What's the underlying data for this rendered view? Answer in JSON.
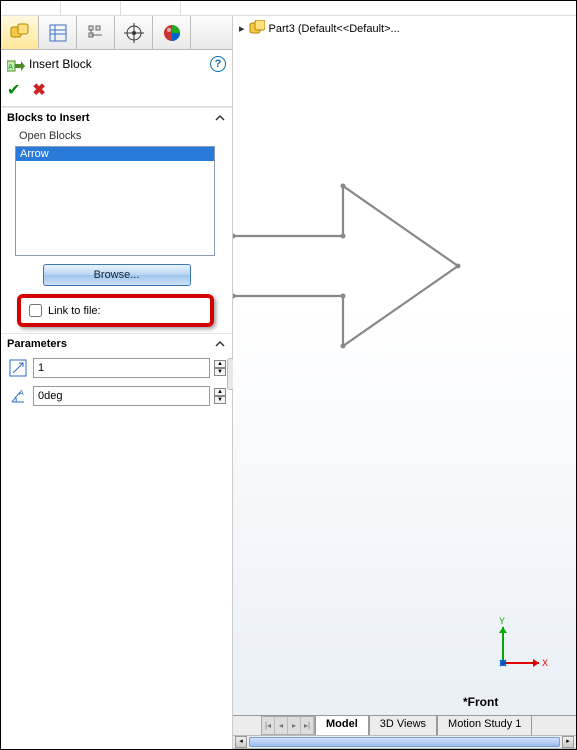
{
  "panel": {
    "title": "Insert Block",
    "sections": {
      "blocks": {
        "label": "Blocks to Insert",
        "sublabel": "Open Blocks",
        "items": [
          "Arrow"
        ],
        "browse_label": "Browse..."
      },
      "linkfile": {
        "label": "Link to file:"
      },
      "parameters": {
        "label": "Parameters",
        "scale_value": "1",
        "angle_value": "0deg"
      }
    }
  },
  "viewport": {
    "breadcrumb": "Part3  (Default<<Default>...",
    "axis_x": "X",
    "axis_y": "Y",
    "view_label": "*Front"
  },
  "tabs": {
    "model": "Model",
    "views3d": "3D Views",
    "motion": "Motion Study 1"
  }
}
